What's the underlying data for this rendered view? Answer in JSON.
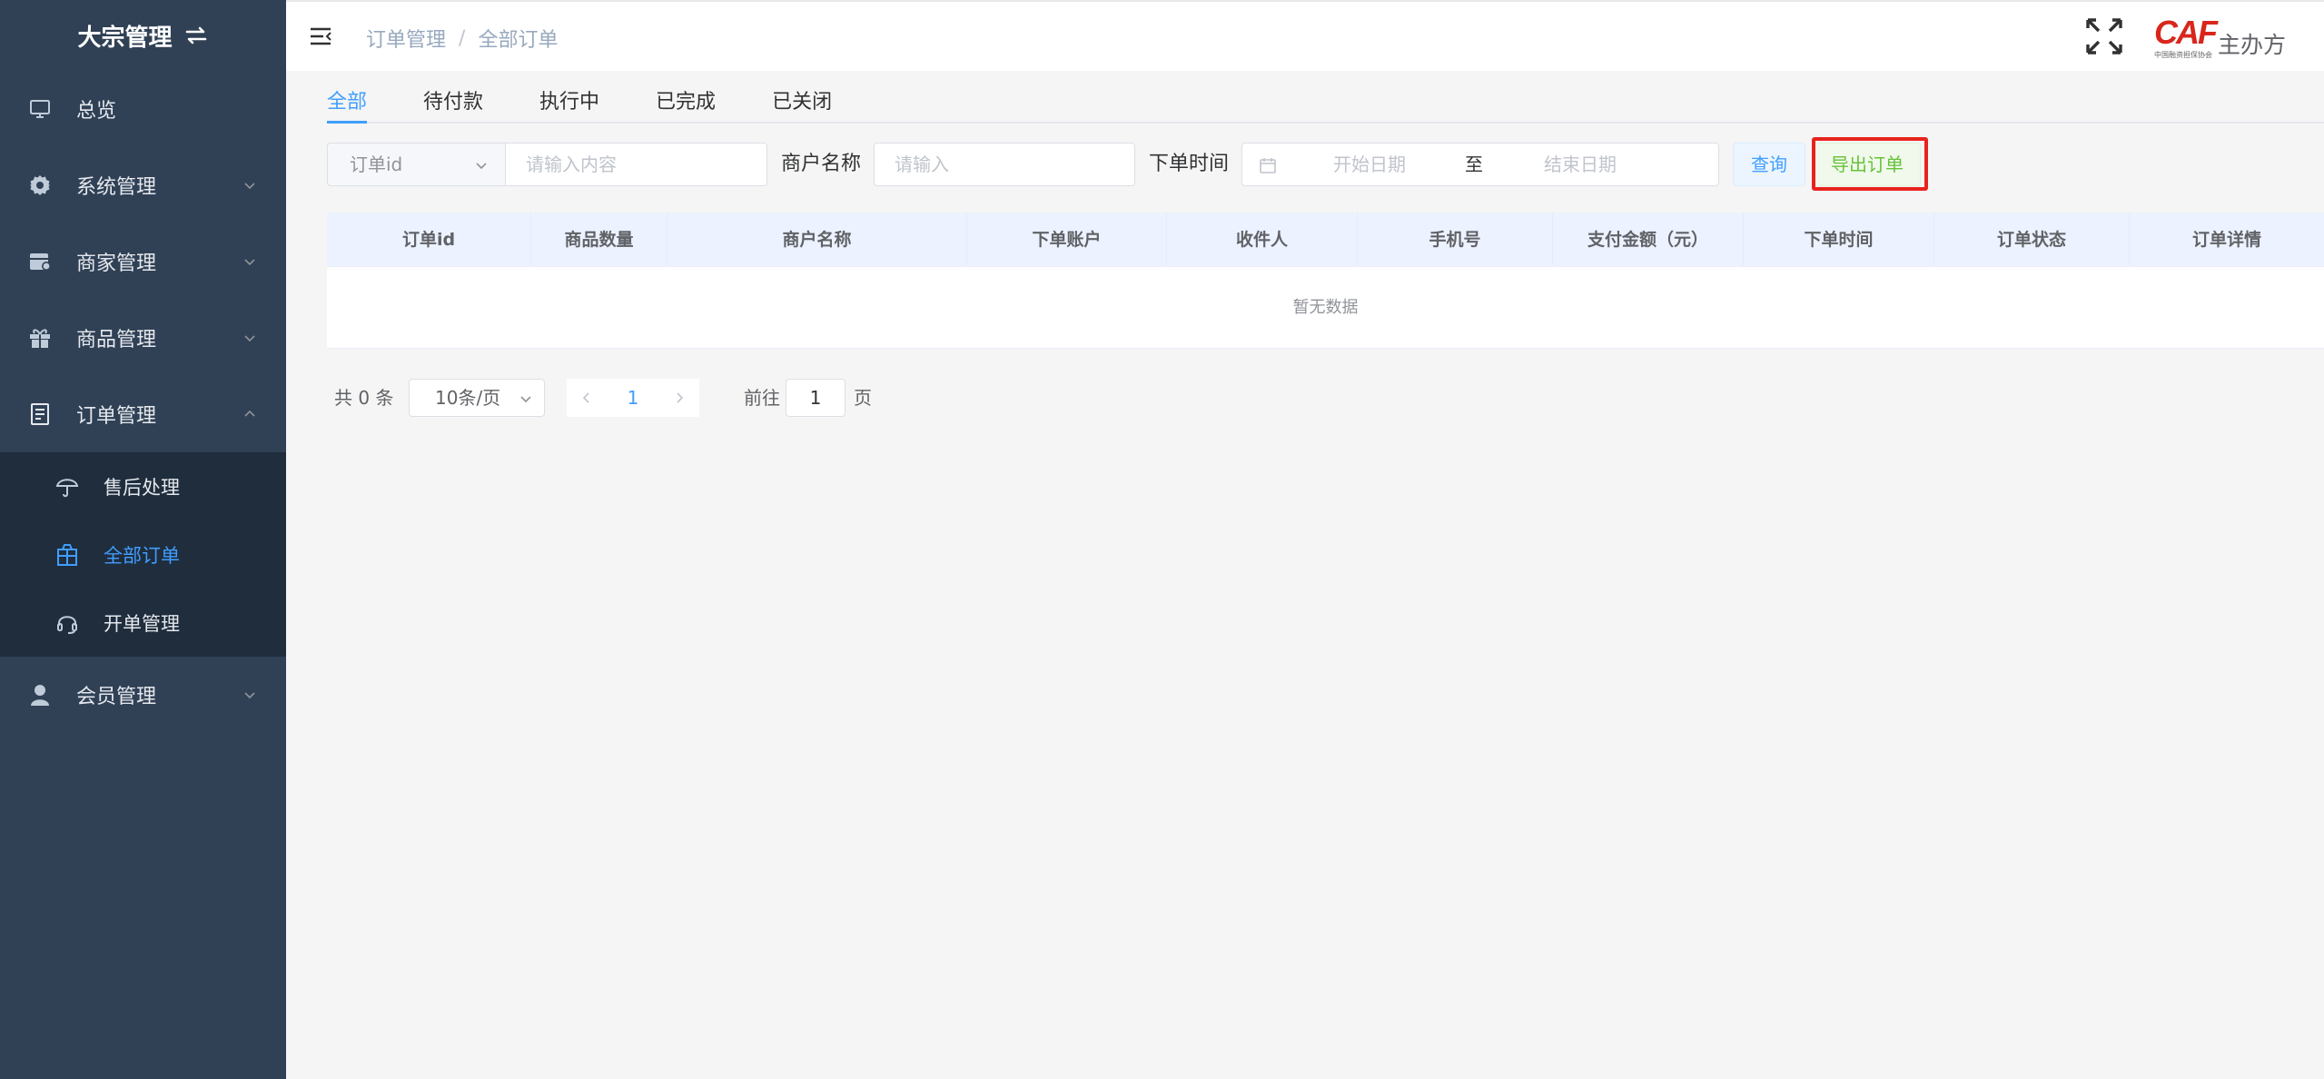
{
  "sidebar": {
    "brand": "大宗管理",
    "items": [
      {
        "label": "总览",
        "icon": "monitor-icon"
      },
      {
        "label": "系统管理",
        "icon": "gear-icon"
      },
      {
        "label": "商家管理",
        "icon": "shop-icon"
      },
      {
        "label": "商品管理",
        "icon": "gift-icon"
      },
      {
        "label": "订单管理",
        "icon": "document-icon"
      },
      {
        "label": "会员管理",
        "icon": "user-icon"
      }
    ],
    "submenu": [
      {
        "label": "售后处理",
        "icon": "umbrella-icon"
      },
      {
        "label": "全部订单",
        "icon": "package-icon",
        "active": true
      },
      {
        "label": "开单管理",
        "icon": "headset-icon"
      }
    ]
  },
  "header": {
    "breadcrumb": [
      "订单管理",
      "全部订单"
    ],
    "logo_text": "CAF",
    "logo_subtext": "中国融资担保协会",
    "host_name": "主办方"
  },
  "tabs": [
    "全部",
    "待付款",
    "执行中",
    "已完成",
    "已关闭"
  ],
  "filters": {
    "order_select": "订单id",
    "order_input_placeholder": "请输入内容",
    "merchant_label": "商户名称",
    "merchant_placeholder": "请输入",
    "time_label": "下单时间",
    "start_placeholder": "开始日期",
    "range_separator": "至",
    "end_placeholder": "结束日期",
    "query_button": "查询",
    "export_button": "导出订单"
  },
  "table": {
    "columns": [
      "订单id",
      "商品数量",
      "商户名称",
      "下单账户",
      "收件人",
      "手机号",
      "支付金额（元）",
      "下单时间",
      "订单状态",
      "订单详情"
    ],
    "empty_text": "暂无数据"
  },
  "pagination": {
    "total": "共 0 条",
    "page_size": "10条/页",
    "current_page": "1",
    "goto_label": "前往",
    "goto_value": "1",
    "goto_unit": "页"
  },
  "colors": {
    "sidebar_bg": "#304156",
    "submenu_bg": "#1f2d3d",
    "accent": "#409eff",
    "export_green": "#67c23a",
    "highlight_red": "#e8231d"
  }
}
